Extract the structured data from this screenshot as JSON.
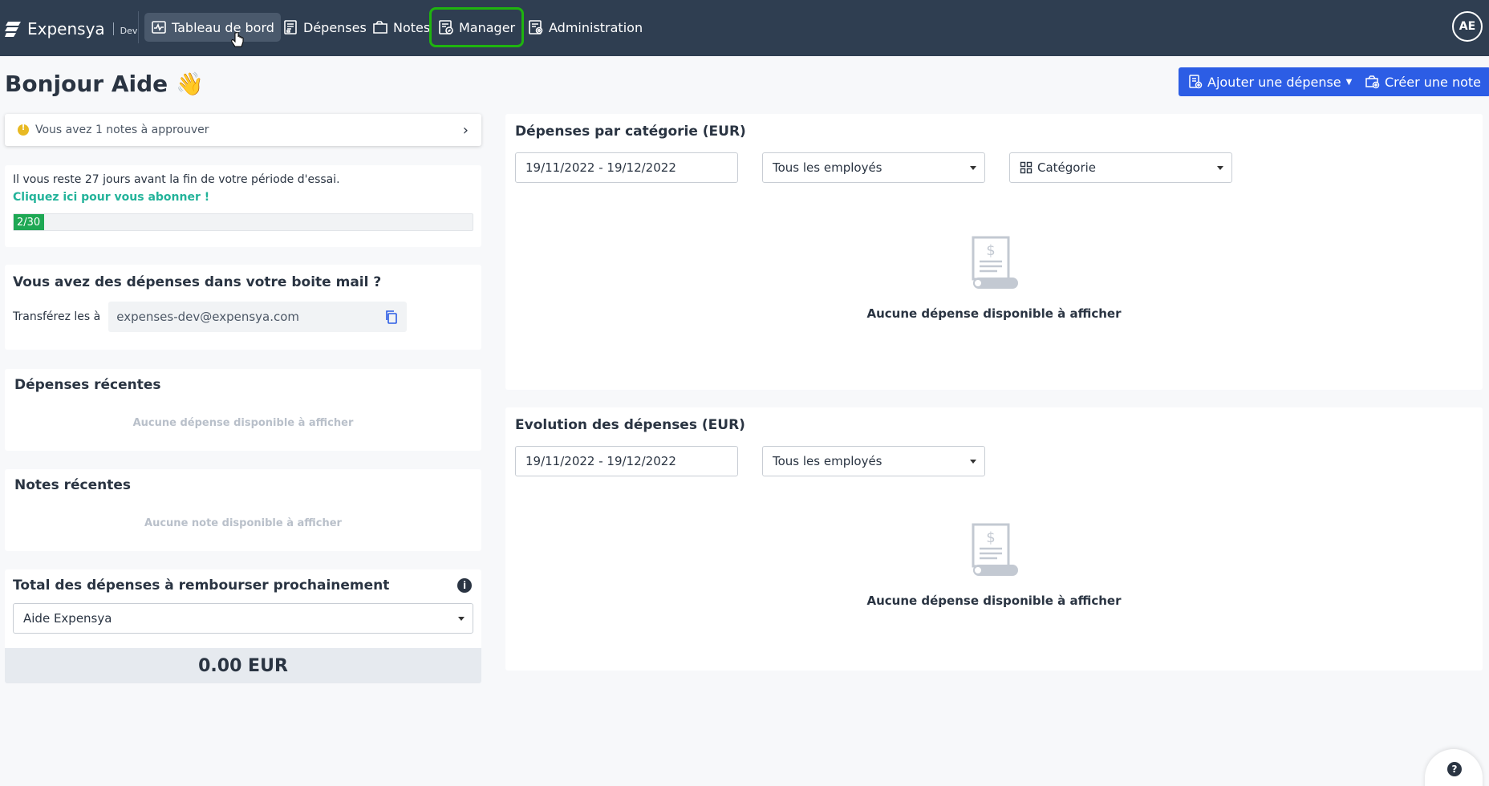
{
  "nav": {
    "brand": "Expensya",
    "env": "Dev",
    "items": [
      {
        "label": "Tableau de bord",
        "icon": "dashboard-icon"
      },
      {
        "label": "Dépenses",
        "icon": "receipt-icon"
      },
      {
        "label": "Notes",
        "icon": "folder-icon"
      },
      {
        "label": "Manager",
        "icon": "manager-icon"
      },
      {
        "label": "Administration",
        "icon": "admin-icon"
      }
    ],
    "avatar": "AE"
  },
  "header": {
    "greeting": "Bonjour Aide",
    "wave": "👋",
    "add_expense": "Ajouter une dépense",
    "create_note": "Créer une note"
  },
  "approvals": {
    "text": "Vous avez 1 notes à approuver"
  },
  "trial": {
    "text": "Il vous reste 27 jours avant la fin de votre période d'essai.",
    "link": "Cliquez ici pour vous abonner !",
    "progress_label": "2/30",
    "progress_fraction": 0.0667
  },
  "mail": {
    "title": "Vous avez des dépenses dans votre boite mail ?",
    "label": "Transférez les à",
    "address": "expenses-dev@expensya.com"
  },
  "recent_expenses": {
    "title": "Dépenses récentes",
    "empty": "Aucune dépense disponible à afficher"
  },
  "recent_notes": {
    "title": "Notes récentes",
    "empty": "Aucune note disponible à afficher"
  },
  "total": {
    "title": "Total des dépenses à rembourser prochainement",
    "selected": "Aide Expensya",
    "amount": "0.00 EUR"
  },
  "by_category": {
    "title": "Dépenses par catégorie (EUR)",
    "date_range": "19/11/2022 - 19/12/2022",
    "employees": "Tous les employés",
    "category": "Catégorie",
    "empty": "Aucune dépense disponible à afficher"
  },
  "evolution": {
    "title": "Evolution des dépenses (EUR)",
    "date_range": "19/11/2022 - 19/12/2022",
    "employees": "Tous les employés",
    "empty": "Aucune dépense disponible à afficher"
  },
  "colors": {
    "nav_bg": "#2f3e51",
    "primary": "#2c5de5",
    "progress": "#1ea854",
    "link": "#23b39a",
    "highlight": "#1fb40f"
  }
}
